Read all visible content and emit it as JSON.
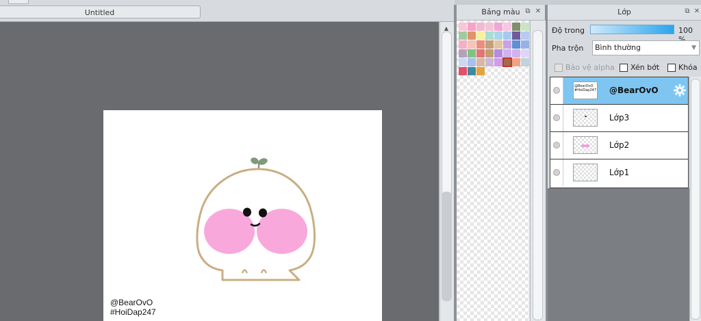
{
  "document": {
    "tab_title": "Untitled"
  },
  "canvas": {
    "watermark_line1": "@BearOvO",
    "watermark_line2": "#HoiDap247",
    "colors": {
      "outline": "#c9ae83",
      "blush": "#f9a8dc",
      "sprout": "#7f9a7a",
      "eyes": "#111111"
    }
  },
  "palette_panel": {
    "title": "Bảng màu",
    "swatches": [
      "#f7c7d8",
      "#f5a3c7",
      "#f4b9d3",
      "#f3c4d8",
      "#f0a6d8",
      "#f6c6e4",
      "#7f8f6e",
      "#c9e5c3",
      "#a3c9a1",
      "#e0956b",
      "#f7f2a0",
      "#a8dcd4",
      "#a9d6ea",
      "#a8c8f0",
      "#6d5b9a",
      "#b9c9f2",
      "#f3b0c7",
      "#f6c4b8",
      "#ee8e7a",
      "#c3a07b",
      "#e4c4a2",
      "#c9a1e4",
      "#5f8fd6",
      "#97b1e6",
      "#b8a0bd",
      "#80c37f",
      "#e27575",
      "#c09f6e",
      "#b48ce0",
      "#d0b3ee",
      "#d4b0f0",
      "#e2d4f7",
      "#cdd7f5",
      "#a8c0ee",
      "#d7b7a4",
      "#cbb6d8",
      "#d19de6",
      "#a06c50",
      "#f0a285",
      "#bfd3df",
      "#e2506a",
      "#3e8aa0",
      "#e4a33c"
    ],
    "selected_index": 37
  },
  "layer_panel": {
    "title": "Lớp",
    "opacity_label": "Độ trong",
    "opacity_value": "100 %",
    "opacity_fraction": 1.0,
    "blend_label": "Pha trộn",
    "blend_value": "Bình thường",
    "protect_alpha_label": "Bảo vệ alpha",
    "clipping_label": "Xén bớt",
    "lock_label": "Khóa",
    "layers": [
      {
        "name": "@BearOvO",
        "active": true,
        "thumb_text": "@BearOvO #HoiDap247"
      },
      {
        "name": "Lớp3",
        "active": false
      },
      {
        "name": "Lớp2",
        "active": false
      },
      {
        "name": "Lớp1",
        "active": false
      }
    ]
  }
}
